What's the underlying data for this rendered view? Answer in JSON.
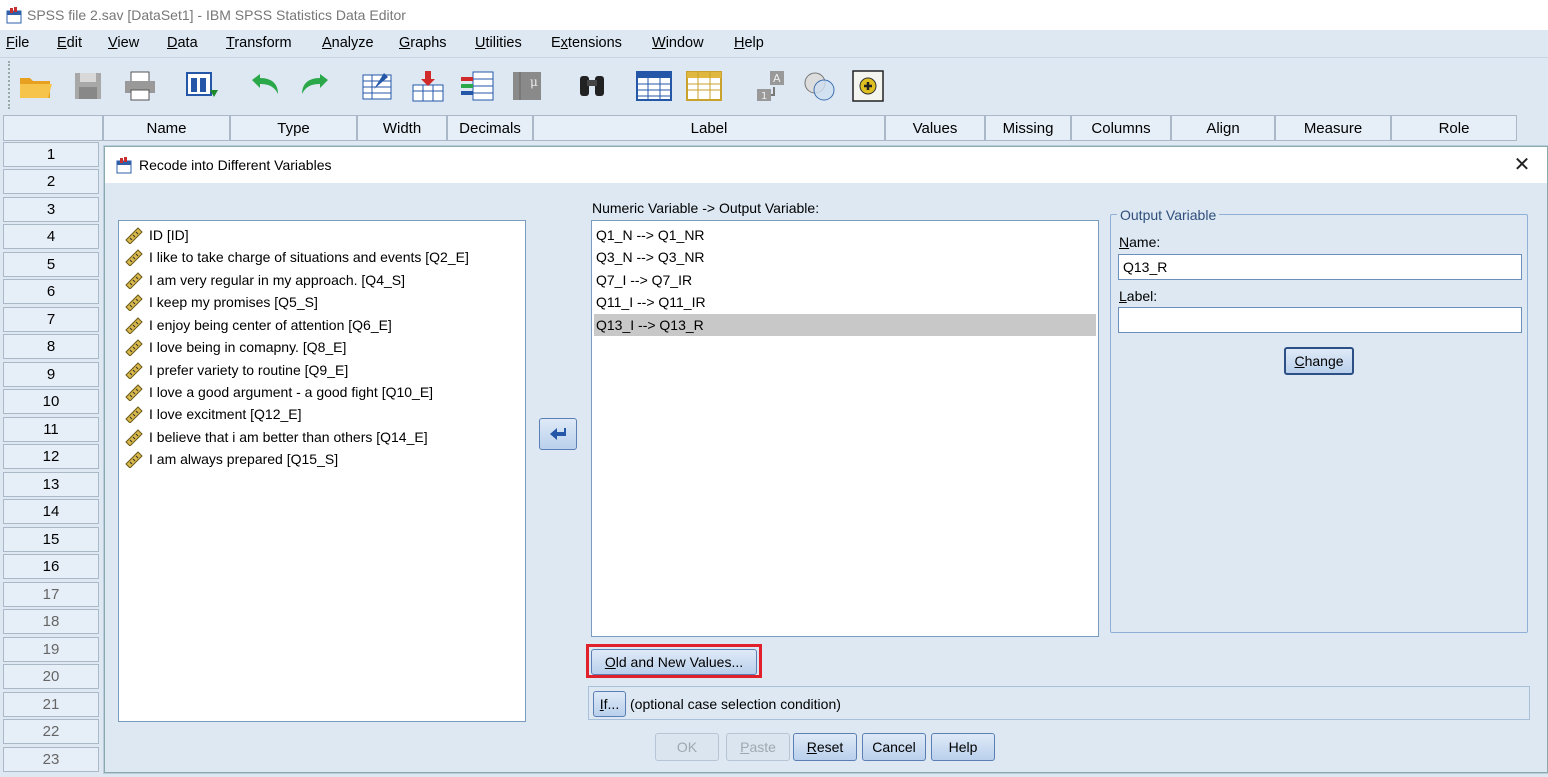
{
  "window": {
    "title": "SPSS file 2.sav [DataSet1] - IBM SPSS Statistics Data Editor"
  },
  "menu": [
    "File",
    "Edit",
    "View",
    "Data",
    "Transform",
    "Analyze",
    "Graphs",
    "Utilities",
    "Extensions",
    "Window",
    "Help"
  ],
  "toolbar_icons": [
    "open-folder-icon",
    "save-icon",
    "print-icon",
    "recall-dialog-icon",
    "undo-icon",
    "redo-icon",
    "goto-case-icon",
    "goto-variable-icon",
    "variables-icon",
    "run-descriptives-icon",
    "find-icon",
    "insert-cases-icon",
    "insert-variable-icon",
    "split-file-icon",
    "weight-cases-icon",
    "select-cases-icon",
    "value-labels-icon"
  ],
  "grid": {
    "columns": [
      "Name",
      "Type",
      "Width",
      "Decimals",
      "Label",
      "Values",
      "Missing",
      "Columns",
      "Align",
      "Measure",
      "Role"
    ],
    "rows": [
      "1",
      "2",
      "3",
      "4",
      "5",
      "6",
      "7",
      "8",
      "9",
      "10",
      "11",
      "12",
      "13",
      "14",
      "15",
      "16",
      "17",
      "18",
      "19",
      "20",
      "21",
      "22",
      "23"
    ]
  },
  "dialog": {
    "title": "Recode into Different Variables",
    "source_variables": [
      "ID [ID]",
      "I like to take charge of situations and events [Q2_E]",
      "I am very regular in my approach. [Q4_S]",
      "I keep my promises [Q5_S]",
      "I enjoy being center of attention [Q6_E]",
      "I love being in comapny. [Q8_E]",
      "I prefer variety to routine [Q9_E]",
      "I love a good argument - a good fight [Q10_E]",
      "I love excitment [Q12_E]",
      "I believe that i am better than others  [Q14_E]",
      "I am always prepared [Q15_S]"
    ],
    "numeric_label": "Numeric Variable -> Output Variable:",
    "mappings": [
      "Q1_N --> Q1_NR",
      "Q3_N --> Q3_NR",
      "Q7_I --> Q7_IR",
      "Q11_I --> Q11_IR",
      "Q13_I --> Q13_R"
    ],
    "selected_mapping": "Q13_I --> Q13_R",
    "output_group": "Output Variable",
    "name_label": "Name:",
    "name_value": "Q13_R",
    "label_label": "Label:",
    "label_value": "",
    "change_button": "Change",
    "old_new_button": "Old and New Values...",
    "if_button": "If...",
    "if_text": "(optional case selection condition)",
    "buttons": {
      "ok": "OK",
      "paste": "Paste",
      "reset": "Reset",
      "cancel": "Cancel",
      "help": "Help"
    }
  },
  "colors": {
    "highlight_border": "#e0202a",
    "menu_bg": "#dde8f3",
    "selected_row": "#c8c8c8"
  }
}
